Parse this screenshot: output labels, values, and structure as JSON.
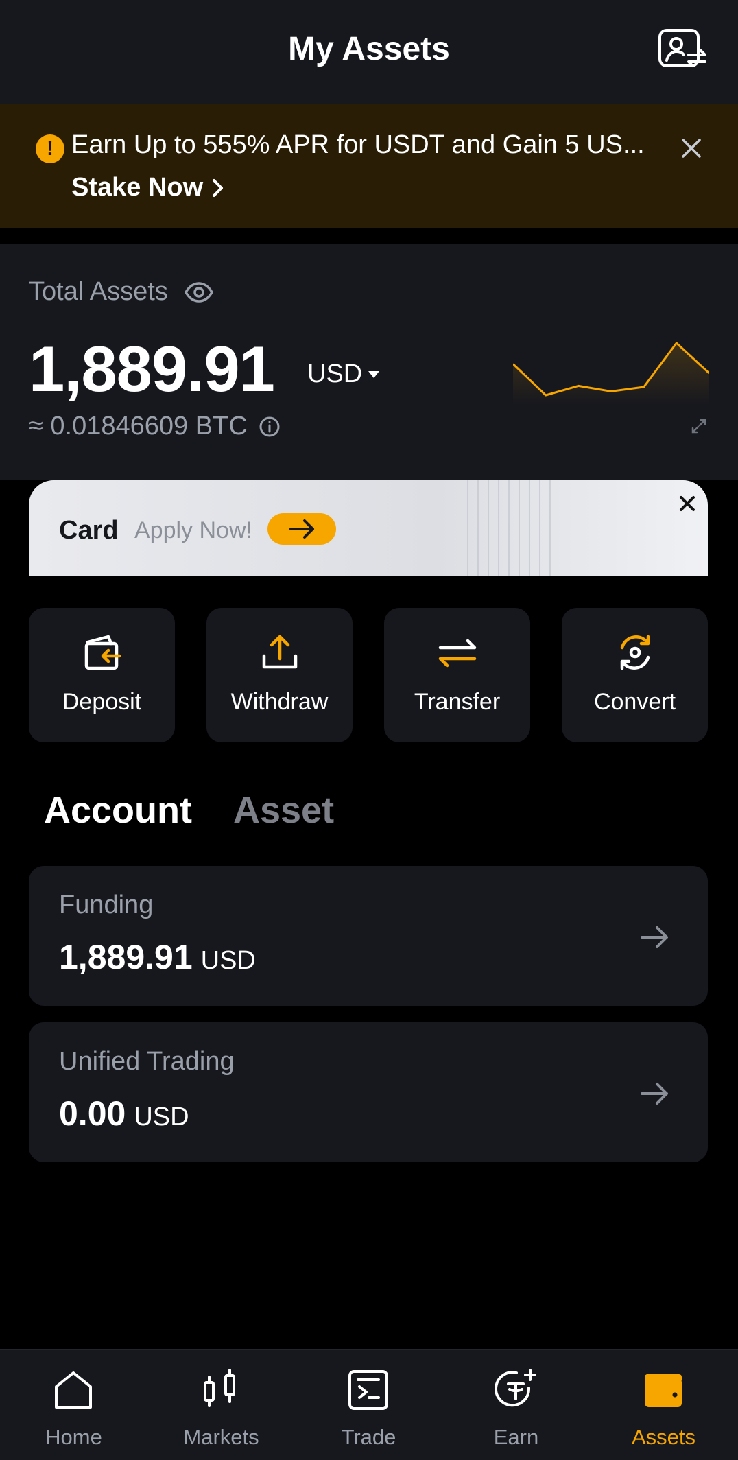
{
  "header": {
    "title": "My Assets",
    "icon": "profile-switch-icon"
  },
  "banner": {
    "text": "Earn Up to 555% APR for USDT and Gain 5 US...",
    "cta": "Stake Now",
    "alert_icon": "exclamation-icon",
    "alert_glyph": "!",
    "close_icon": "close-icon",
    "background": "#2a1d05",
    "accent": "#f7a600"
  },
  "assets": {
    "label": "Total Assets",
    "amount": "1,889.91",
    "currency": "USD",
    "btc_equivalent": "≈ 0.01846609 BTC",
    "trend": [
      0.62,
      0.05,
      0.22,
      0.12,
      0.2,
      1.0,
      0.45
    ]
  },
  "card": {
    "title": "Card",
    "subtitle": "Apply Now!"
  },
  "actions": [
    {
      "label": "Deposit",
      "icon": "deposit-wallet-icon"
    },
    {
      "label": "Withdraw",
      "icon": "withdraw-upload-icon"
    },
    {
      "label": "Transfer",
      "icon": "transfer-arrows-icon"
    },
    {
      "label": "Convert",
      "icon": "convert-cycle-icon"
    }
  ],
  "tabs": [
    {
      "label": "Account",
      "active": true
    },
    {
      "label": "Asset",
      "active": false
    }
  ],
  "accounts": [
    {
      "name": "Funding",
      "amount": "1,889.91",
      "currency": "USD"
    },
    {
      "name": "Unified Trading",
      "amount": "0.00",
      "currency": "USD"
    }
  ],
  "nav": [
    {
      "label": "Home",
      "icon": "home-icon",
      "active": false
    },
    {
      "label": "Markets",
      "icon": "candlestick-icon",
      "active": false
    },
    {
      "label": "Trade",
      "icon": "trade-terminal-icon",
      "active": false
    },
    {
      "label": "Earn",
      "icon": "earn-coin-icon",
      "active": false
    },
    {
      "label": "Assets",
      "icon": "wallet-icon",
      "active": true
    }
  ],
  "colors": {
    "accent": "#f7a600",
    "surface": "#17181e",
    "muted": "#9aa0aa"
  }
}
